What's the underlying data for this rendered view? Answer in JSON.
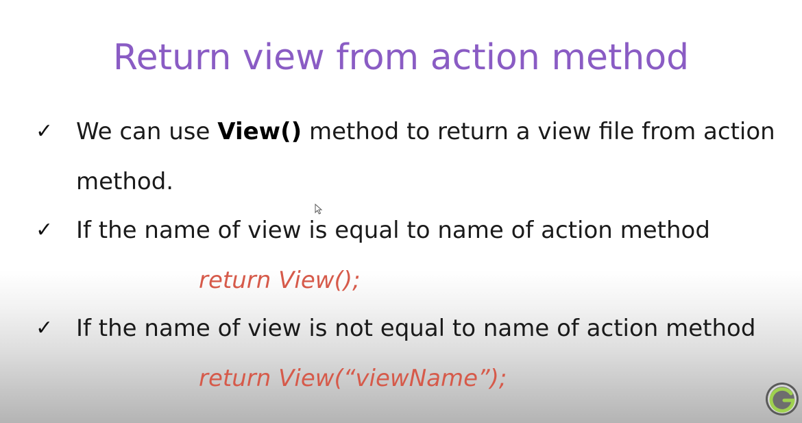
{
  "slide": {
    "title": "Return view from action method",
    "bullets": [
      {
        "check": "✓",
        "prefix": "We can use ",
        "bold": "View()",
        "suffix": " method to return a view file from action",
        "continuation": "method."
      },
      {
        "check": "✓",
        "text": "If the name of view is equal to name of action method",
        "code": "return View();"
      },
      {
        "check": "✓",
        "text": "If the name of view is not equal to name of action method",
        "code": "return View(“viewName”);"
      }
    ]
  },
  "colors": {
    "title": "#8a5cc4",
    "code": "#d65a4a",
    "logo_ring": "#8fc44a",
    "logo_bg": "#5a5a5a"
  },
  "icons": {
    "bullet": "check-icon",
    "cursor": "mouse-pointer-icon",
    "logo": "channel-logo-icon"
  }
}
